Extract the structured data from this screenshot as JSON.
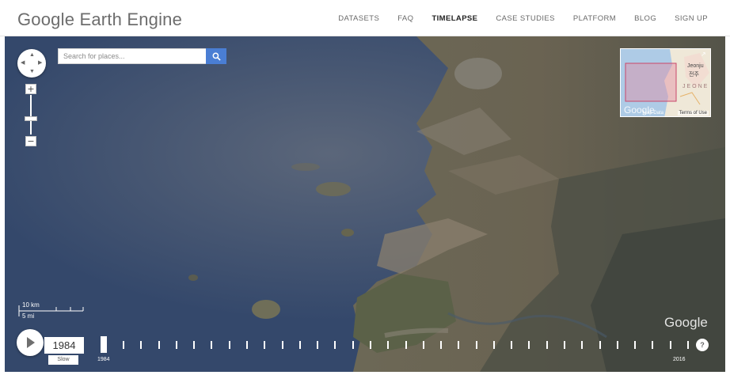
{
  "header": {
    "logo": "Google Earth Engine",
    "nav": [
      {
        "label": "DATASETS",
        "active": false
      },
      {
        "label": "FAQ",
        "active": false
      },
      {
        "label": "TIMELAPSE",
        "active": true
      },
      {
        "label": "CASE STUDIES",
        "active": false
      },
      {
        "label": "PLATFORM",
        "active": false
      },
      {
        "label": "BLOG",
        "active": false
      },
      {
        "label": "SIGN UP",
        "active": false
      }
    ]
  },
  "search": {
    "placeholder": "Search for places...",
    "icon": "search-icon",
    "button_color": "#4a7ed4"
  },
  "zoom": {
    "in_label": "+",
    "out_label": "−"
  },
  "minimap": {
    "city_label": "Jeonju",
    "city_label_local": "전주",
    "region_label": "JEONE",
    "watermark": "Google",
    "footer_data": "Map Data",
    "footer_terms": "Terms of Use"
  },
  "scale": {
    "km": "10 km",
    "mi": "5 mi"
  },
  "watermark": "Google",
  "timelapse": {
    "year": "1984",
    "speed": "Slow",
    "start_year": "1984",
    "end_year": "2016",
    "help": "?",
    "tick_count": 33,
    "progress": 0.0
  },
  "colors": {
    "ocean": "#34476a",
    "land": "#6f6a58",
    "active_nav": "#222222",
    "nav": "#6a6a6a"
  }
}
